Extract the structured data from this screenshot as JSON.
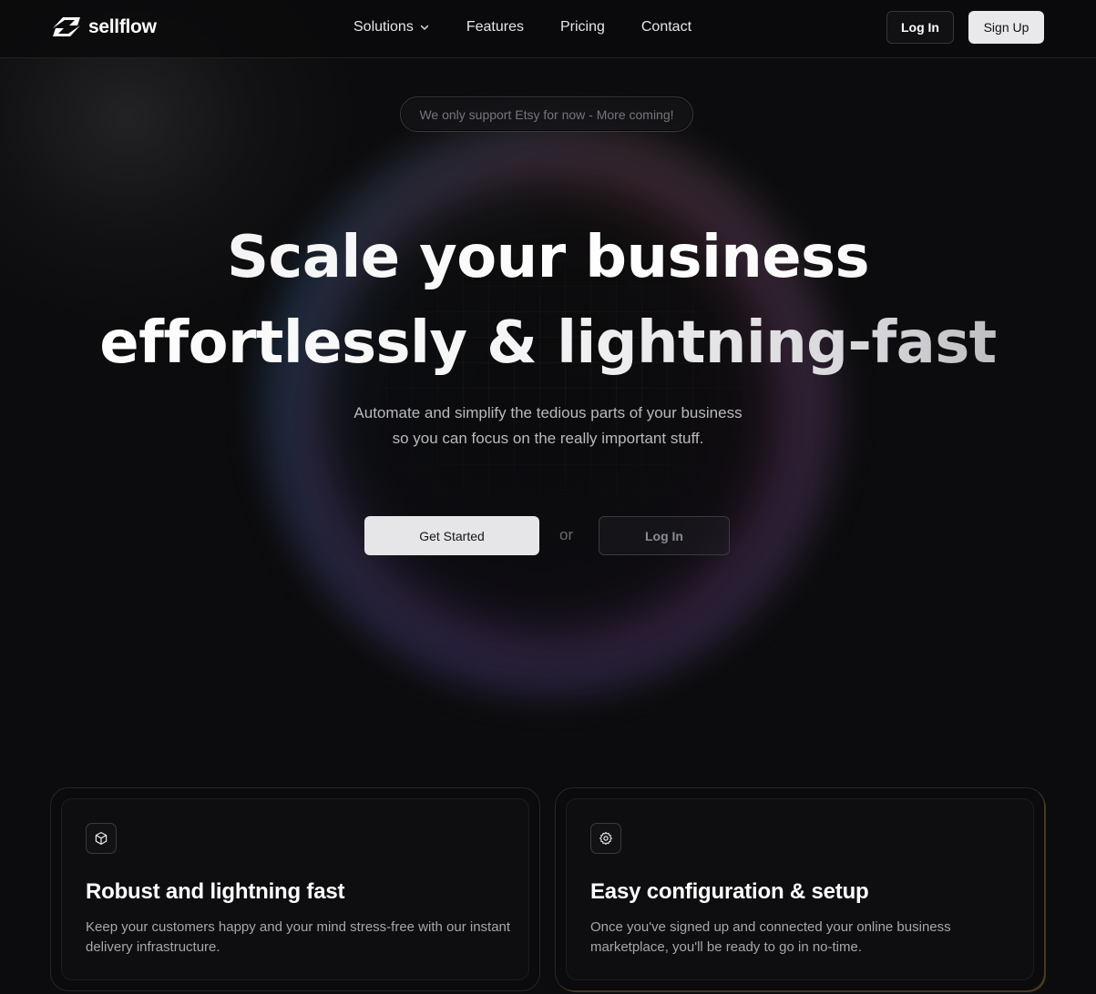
{
  "brand": {
    "name": "sellflow",
    "logo_icon": "sellflow-logo-icon"
  },
  "nav": {
    "items": [
      {
        "label": "Solutions",
        "has_dropdown": true,
        "icon": "chevron-down-icon"
      },
      {
        "label": "Features"
      },
      {
        "label": "Pricing"
      },
      {
        "label": "Contact"
      }
    ],
    "login_label": "Log In",
    "signup_label": "Sign Up"
  },
  "hero": {
    "notice": "We only support Etsy for now - More coming!",
    "title_line_1": "Scale your business",
    "title_line_2": "effortlessly & lightning-fast",
    "subtitle_line_1": "Automate and simplify the tedious parts of your business",
    "subtitle_line_2": "so you can focus on the really important stuff.",
    "primary_cta": "Get Started",
    "or_text": "or",
    "secondary_cta": "Log In"
  },
  "features": [
    {
      "icon": "box-icon",
      "title": "Robust and lightning fast",
      "description": "Keep your customers happy and your mind stress-free with our instant delivery infrastructure."
    },
    {
      "icon": "gear-icon",
      "title": "Easy configuration & setup",
      "description": "Once you've signed up and connected your online business marketplace, you'll be ready to go in no-time."
    }
  ],
  "colors": {
    "background": "#0c0c0e",
    "primary_button": "#e6e6e9",
    "text": "#f2f2f3",
    "muted_text": "#a6a6ac",
    "card_accent": "#be8c3c"
  }
}
